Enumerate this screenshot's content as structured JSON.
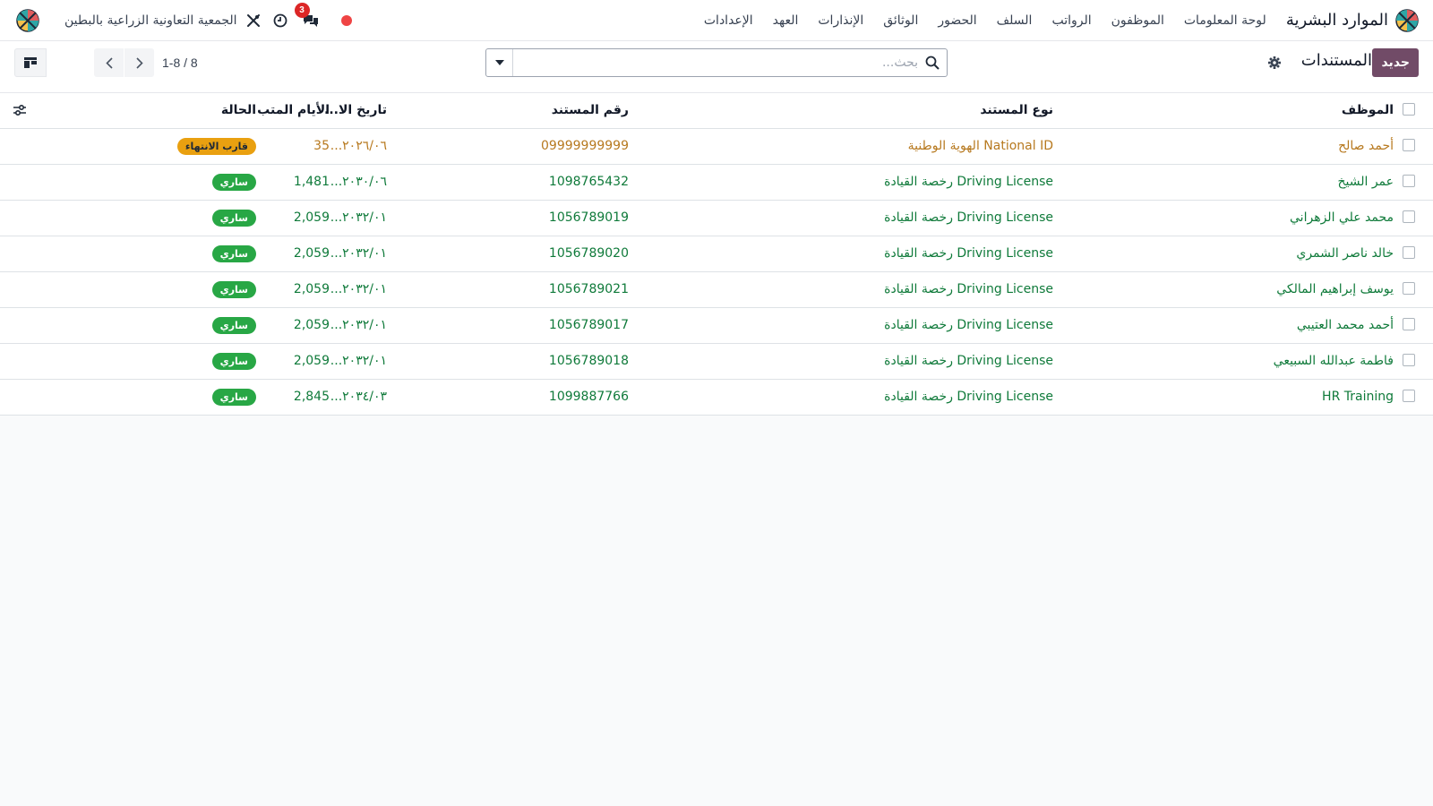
{
  "navbar": {
    "app_name": "الموارد البشرية",
    "menu": [
      "لوحة المعلومات",
      "الموظفون",
      "الرواتب",
      "السلف",
      "الحضور",
      "الوثائق",
      "الإنذارات",
      "العهد",
      "الإعدادات"
    ],
    "company": "الجمعية التعاونية الزراعية بالبطين",
    "message_count": "3"
  },
  "control": {
    "new_label": "جديد",
    "title": "المستندات",
    "search_placeholder": "بحث...",
    "pager": "1-8 / 8"
  },
  "table": {
    "headers": {
      "employee": "الموظف",
      "doc_type": "نوع المستند",
      "doc_number": "رقم المستند",
      "expiry_date": "تاريخ الا...",
      "days_left": "الأيام المتب...",
      "state": "الحالة"
    },
    "rows": [
      {
        "employee": "أحمد صالح",
        "doc_type": "National ID الهوية الوطنية",
        "doc_number": "09999999999",
        "expiry_date": "٢٠٢٦/٠٦...",
        "days_left": "35",
        "state": "قارب الانتهاء",
        "state_kind": "near"
      },
      {
        "employee": "عمر الشيخ",
        "doc_type": "Driving License رخصة القيادة",
        "doc_number": "1098765432",
        "expiry_date": "٢٠٣٠/٠٦...",
        "days_left": "1,481",
        "state": "ساري",
        "state_kind": "active"
      },
      {
        "employee": "محمد علي الزهراني",
        "doc_type": "Driving License رخصة القيادة",
        "doc_number": "1056789019",
        "expiry_date": "٢٠٣٢/٠١...",
        "days_left": "2,059",
        "state": "ساري",
        "state_kind": "active"
      },
      {
        "employee": "خالد ناصر الشمري",
        "doc_type": "Driving License رخصة القيادة",
        "doc_number": "1056789020",
        "expiry_date": "٢٠٣٢/٠١...",
        "days_left": "2,059",
        "state": "ساري",
        "state_kind": "active"
      },
      {
        "employee": "يوسف إبراهيم المالكي",
        "doc_type": "Driving License رخصة القيادة",
        "doc_number": "1056789021",
        "expiry_date": "٢٠٣٢/٠١...",
        "days_left": "2,059",
        "state": "ساري",
        "state_kind": "active"
      },
      {
        "employee": "أحمد محمد العتيبي",
        "doc_type": "Driving License رخصة القيادة",
        "doc_number": "1056789017",
        "expiry_date": "٢٠٣٢/٠١...",
        "days_left": "2,059",
        "state": "ساري",
        "state_kind": "active"
      },
      {
        "employee": "فاطمة عبدالله السبيعي",
        "doc_type": "Driving License رخصة القيادة",
        "doc_number": "1056789018",
        "expiry_date": "٢٠٣٢/٠١...",
        "days_left": "2,059",
        "state": "ساري",
        "state_kind": "active"
      },
      {
        "employee": "HR Training",
        "doc_type": "Driving License رخصة القيادة",
        "doc_number": "1099887766",
        "expiry_date": "٢٠٣٤/٠٣...",
        "days_left": "2,845",
        "state": "ساري",
        "state_kind": "active"
      }
    ]
  },
  "colors": {
    "brand": "#714b67",
    "accent": "#017e84",
    "active_badge": "#28a745",
    "near_badge": "#e9a010",
    "danger": "#dc2626"
  }
}
